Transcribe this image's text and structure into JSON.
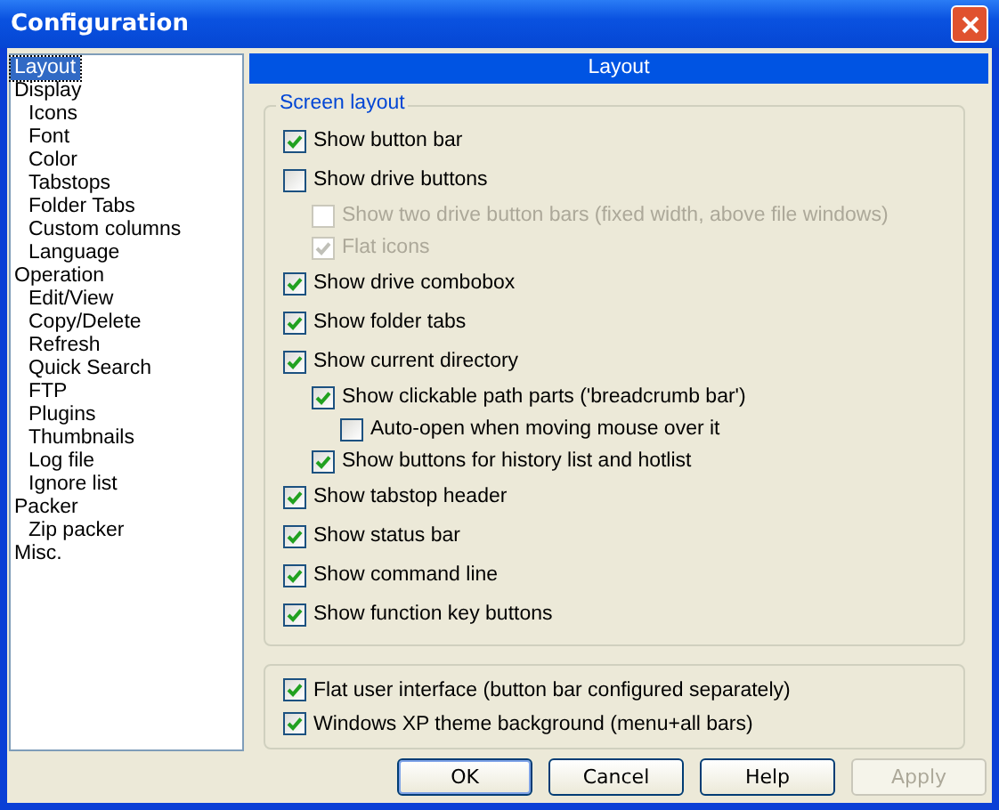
{
  "window": {
    "title": "Configuration"
  },
  "tree": [
    {
      "label": "Layout",
      "selected": true
    },
    {
      "label": "Display",
      "selected": false,
      "children": [
        {
          "label": "Icons",
          "selected": false
        },
        {
          "label": "Font",
          "selected": false
        },
        {
          "label": "Color",
          "selected": false
        },
        {
          "label": "Tabstops",
          "selected": false
        },
        {
          "label": "Folder Tabs",
          "selected": false
        },
        {
          "label": "Custom columns",
          "selected": false
        },
        {
          "label": "Language",
          "selected": false
        }
      ]
    },
    {
      "label": "Operation",
      "selected": false,
      "children": [
        {
          "label": "Edit/View",
          "selected": false
        },
        {
          "label": "Copy/Delete",
          "selected": false
        },
        {
          "label": "Refresh",
          "selected": false
        },
        {
          "label": "Quick Search",
          "selected": false
        },
        {
          "label": "FTP",
          "selected": false
        },
        {
          "label": "Plugins",
          "selected": false
        },
        {
          "label": "Thumbnails",
          "selected": false
        },
        {
          "label": "Log file",
          "selected": false
        },
        {
          "label": "Ignore list",
          "selected": false
        }
      ]
    },
    {
      "label": "Packer",
      "selected": false,
      "children": [
        {
          "label": "Zip packer",
          "selected": false
        }
      ]
    },
    {
      "label": "Misc.",
      "selected": false
    }
  ],
  "panel": {
    "header": "Layout",
    "group_title": "Screen layout",
    "options": [
      {
        "label": "Show button bar",
        "checked": true,
        "disabled": false
      },
      {
        "label": "Show drive buttons",
        "checked": false,
        "disabled": false,
        "children": [
          {
            "label": "Show two drive button bars (fixed width, above file windows)",
            "checked": false,
            "disabled": true
          },
          {
            "label": "Flat icons",
            "checked": true,
            "disabled": true
          }
        ]
      },
      {
        "label": "Show drive combobox",
        "checked": true,
        "disabled": false
      },
      {
        "label": "Show folder tabs",
        "checked": true,
        "disabled": false
      },
      {
        "label": "Show current directory",
        "checked": true,
        "disabled": false,
        "children": [
          {
            "label": "Show clickable path parts ('breadcrumb bar')",
            "checked": true,
            "disabled": false,
            "children": [
              {
                "label": "Auto-open when moving mouse over it",
                "checked": false,
                "disabled": false
              }
            ]
          },
          {
            "label": "Show buttons for history list and hotlist",
            "checked": true,
            "disabled": false
          }
        ]
      },
      {
        "label": "Show tabstop header",
        "checked": true,
        "disabled": false
      },
      {
        "label": "Show status bar",
        "checked": true,
        "disabled": false
      },
      {
        "label": "Show command line",
        "checked": true,
        "disabled": false
      },
      {
        "label": "Show function key buttons",
        "checked": true,
        "disabled": false
      }
    ],
    "extra_options": [
      {
        "label": "Flat user interface (button bar configured separately)",
        "checked": true,
        "disabled": false
      },
      {
        "label": "Windows XP theme background (menu+all bars)",
        "checked": true,
        "disabled": false
      }
    ]
  },
  "buttons": [
    {
      "label": "OK",
      "disabled": false,
      "default": true
    },
    {
      "label": "Cancel",
      "disabled": false,
      "default": false
    },
    {
      "label": "Help",
      "disabled": false,
      "default": false
    },
    {
      "label": "Apply",
      "disabled": true,
      "default": false
    }
  ]
}
